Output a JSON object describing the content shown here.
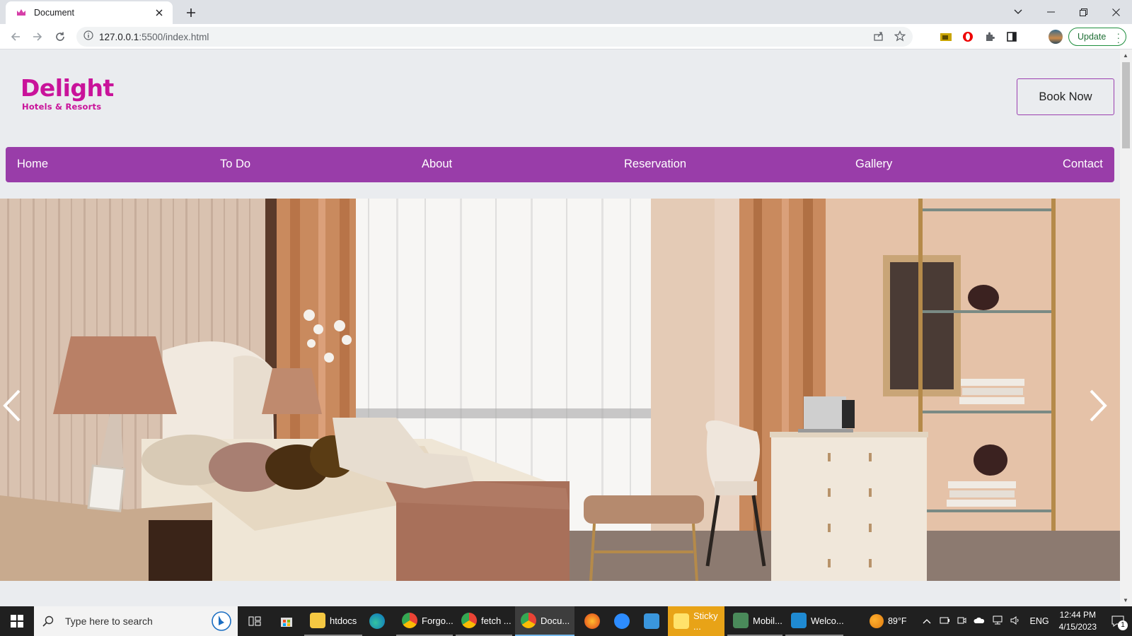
{
  "browser": {
    "tab": {
      "title": "Document"
    },
    "address": {
      "host": "127.0.0.1",
      "path": ":5500/index.html"
    },
    "update_label": "Update"
  },
  "site": {
    "logo": {
      "name": "Delight",
      "tagline": "Hotels & Resorts"
    },
    "book_now": "Book Now",
    "nav": [
      "Home",
      "To Do",
      "About",
      "Reservation",
      "Gallery",
      "Contact"
    ],
    "hero": {
      "prev_icon": "chevron-left-icon",
      "next_icon": "chevron-right-icon"
    }
  },
  "colors": {
    "brand": "#c9139a",
    "nav_bg": "#993da9",
    "page_bg": "#eaecef"
  },
  "taskbar": {
    "search_placeholder": "Type here to search",
    "apps": [
      {
        "label": "htdocs",
        "icon": "folder-icon"
      },
      {
        "label": "",
        "icon": "edge-icon"
      },
      {
        "label": "Forgo...",
        "icon": "chrome-icon"
      },
      {
        "label": "fetch ...",
        "icon": "chrome-icon"
      },
      {
        "label": "Docu...",
        "icon": "chrome-icon"
      },
      {
        "label": "",
        "icon": "firefox-icon"
      },
      {
        "label": "",
        "icon": "zoom-icon"
      },
      {
        "label": "",
        "icon": "mail-icon"
      },
      {
        "label": "Sticky ...",
        "icon": "sticky-notes-icon"
      },
      {
        "label": "Mobil...",
        "icon": "mobile-app-icon"
      },
      {
        "label": "Welco...",
        "icon": "vscode-icon"
      }
    ],
    "weather": "89°F",
    "language": "ENG",
    "time": "12:44 PM",
    "date": "4/15/2023",
    "notification_count": "1"
  }
}
